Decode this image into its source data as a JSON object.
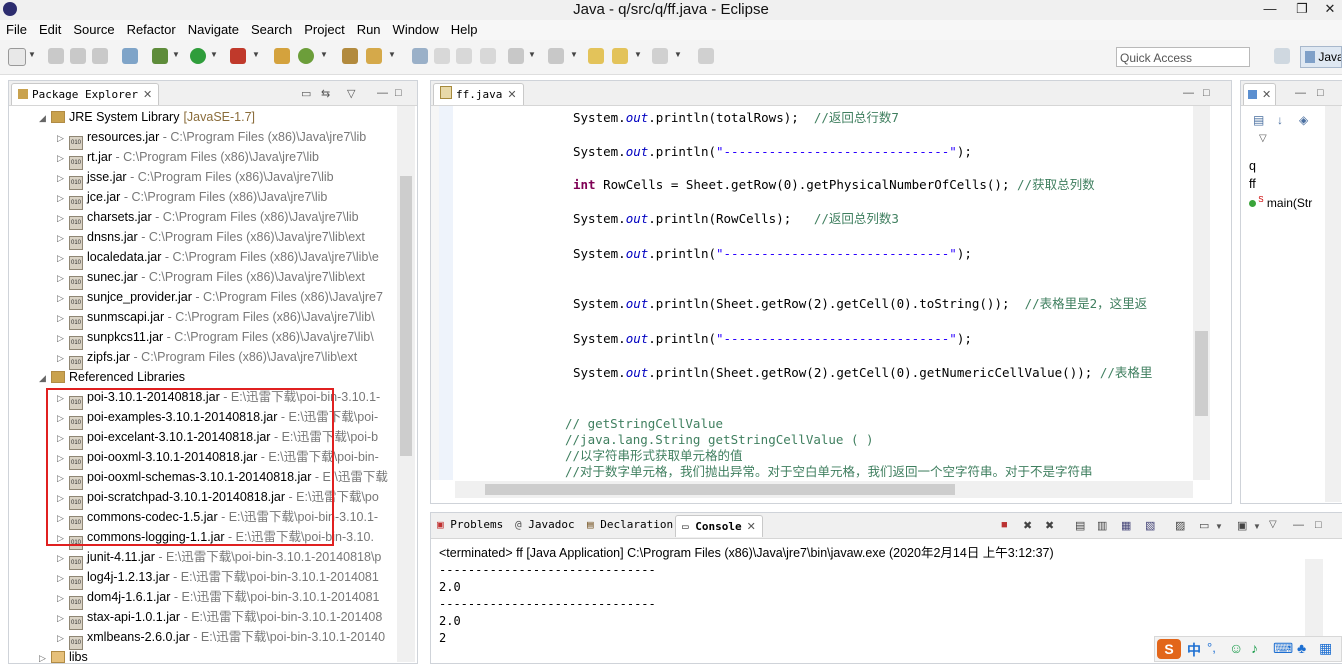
{
  "window": {
    "title": "Java - q/src/q/ff.java - Eclipse",
    "minimize": "—",
    "restore": "❐",
    "close": "✕"
  },
  "menu": [
    "File",
    "Edit",
    "Source",
    "Refactor",
    "Navigate",
    "Search",
    "Project",
    "Run",
    "Window",
    "Help"
  ],
  "toolbar": {
    "quick_access_placeholder": "Quick Access",
    "perspective_label": "Java"
  },
  "package_explorer": {
    "tab_label": "Package Explorer",
    "jre": {
      "label": "JRE System Library",
      "version": "[JavaSE-1.7]"
    },
    "jre_jars": [
      {
        "name": "resources.jar",
        "path": " - C:\\Program Files (x86)\\Java\\jre7\\lib"
      },
      {
        "name": "rt.jar",
        "path": " - C:\\Program Files (x86)\\Java\\jre7\\lib"
      },
      {
        "name": "jsse.jar",
        "path": " - C:\\Program Files (x86)\\Java\\jre7\\lib"
      },
      {
        "name": "jce.jar",
        "path": " - C:\\Program Files (x86)\\Java\\jre7\\lib"
      },
      {
        "name": "charsets.jar",
        "path": " - C:\\Program Files (x86)\\Java\\jre7\\lib"
      },
      {
        "name": "dnsns.jar",
        "path": " - C:\\Program Files (x86)\\Java\\jre7\\lib\\ext"
      },
      {
        "name": "localedata.jar",
        "path": " - C:\\Program Files (x86)\\Java\\jre7\\lib\\e"
      },
      {
        "name": "sunec.jar",
        "path": " - C:\\Program Files (x86)\\Java\\jre7\\lib\\ext"
      },
      {
        "name": "sunjce_provider.jar",
        "path": " - C:\\Program Files (x86)\\Java\\jre7"
      },
      {
        "name": "sunmscapi.jar",
        "path": " - C:\\Program Files (x86)\\Java\\jre7\\lib\\"
      },
      {
        "name": "sunpkcs11.jar",
        "path": " - C:\\Program Files (x86)\\Java\\jre7\\lib\\"
      },
      {
        "name": "zipfs.jar",
        "path": " - C:\\Program Files (x86)\\Java\\jre7\\lib\\ext"
      }
    ],
    "ref_libs_label": "Referenced Libraries",
    "ref_jars": [
      {
        "name": "poi-3.10.1-20140818.jar",
        "path": " - E:\\迅雷下载\\poi-bin-3.10.1-"
      },
      {
        "name": "poi-examples-3.10.1-20140818.jar",
        "path": " - E:\\迅雷下载\\poi-"
      },
      {
        "name": "poi-excelant-3.10.1-20140818.jar",
        "path": " - E:\\迅雷下载\\poi-b"
      },
      {
        "name": "poi-ooxml-3.10.1-20140818.jar",
        "path": " - E:\\迅雷下载\\poi-bin-"
      },
      {
        "name": "poi-ooxml-schemas-3.10.1-20140818.jar",
        "path": " - E:\\迅雷下载"
      },
      {
        "name": "poi-scratchpad-3.10.1-20140818.jar",
        "path": " - E:\\迅雷下载\\po"
      },
      {
        "name": "commons-codec-1.5.jar",
        "path": " - E:\\迅雷下载\\poi-bin-3.10.1-"
      },
      {
        "name": "commons-logging-1.1.jar",
        "path": " - E:\\迅雷下载\\poi-bin-3.10."
      },
      {
        "name": "junit-4.11.jar",
        "path": " - E:\\迅雷下载\\poi-bin-3.10.1-20140818\\p"
      },
      {
        "name": "log4j-1.2.13.jar",
        "path": " - E:\\迅雷下载\\poi-bin-3.10.1-2014081"
      },
      {
        "name": "dom4j-1.6.1.jar",
        "path": " - E:\\迅雷下载\\poi-bin-3.10.1-2014081"
      },
      {
        "name": "stax-api-1.0.1.jar",
        "path": " - E:\\迅雷下载\\poi-bin-3.10.1-201408"
      },
      {
        "name": "xmlbeans-2.6.0.jar",
        "path": " - E:\\迅雷下载\\poi-bin-3.10.1-20140"
      }
    ],
    "libs_label": "libs"
  },
  "editor": {
    "tab_label": "ff.java",
    "lines": {
      "l1_a": "System.",
      "l1_f": "out",
      "l1_b": ".println(totalRows);  ",
      "l1_c": "//返回总行数7",
      "l2_a": "System.",
      "l2_f": "out",
      "l2_b": ".println(",
      "l2_s": "\"------------------------------\"",
      "l2_e": ");",
      "l3_k": "int",
      "l3_b": " RowCells = Sheet.getRow(0).getPhysicalNumberOfCells(); ",
      "l3_c": "//获取总列数",
      "l4_a": "System.",
      "l4_f": "out",
      "l4_b": ".println(RowCells);   ",
      "l4_c": "//返回总列数3",
      "l5_a": "System.",
      "l5_f": "out",
      "l5_b": ".println(",
      "l5_s": "\"------------------------------\"",
      "l5_e": ");",
      "l6_a": "System.",
      "l6_f": "out",
      "l6_b": ".println(Sheet.getRow(2).getCell(0).toString());  ",
      "l6_c": "//表格里是2，这里返",
      "l7_a": "System.",
      "l7_f": "out",
      "l7_b": ".println(",
      "l7_s": "\"------------------------------\"",
      "l7_e": ");",
      "l8_a": "System.",
      "l8_f": "out",
      "l8_b": ".println(Sheet.getRow(2).getCell(0).getNumericCellValue()); ",
      "l8_c": "//表格里",
      "c1": "// getStringCellValue",
      "c2": "//java.lang.String getStringCellValue ( )",
      "c3": "//以字符串形式获取单元格的值",
      "c4": "//对于数字单元格，我们抛出异常。对于空白单元格，我们返回一个空字符串。对于不是字符串"
    }
  },
  "outline": {
    "items": [
      "q",
      "ff",
      "main(Str"
    ]
  },
  "bottom_tabs": {
    "problems": "Problems",
    "javadoc": "Javadoc",
    "declaration": "Declaration",
    "console": "Console"
  },
  "console": {
    "header": "<terminated> ff [Java Application] C:\\Program Files (x86)\\Java\\jre7\\bin\\javaw.exe (2020年2月14日 上午3:12:37)",
    "lines": [
      "------------------------------",
      "2.0",
      "------------------------------",
      "2.0",
      "2"
    ]
  },
  "ime": {
    "lang": "中",
    "punct": "°,"
  },
  "colors": {
    "highlight_box": "#e02020",
    "keyword": "#7f0055",
    "field": "#0000c0",
    "string": "#2a00ff",
    "comment": "#3f7f5f"
  }
}
